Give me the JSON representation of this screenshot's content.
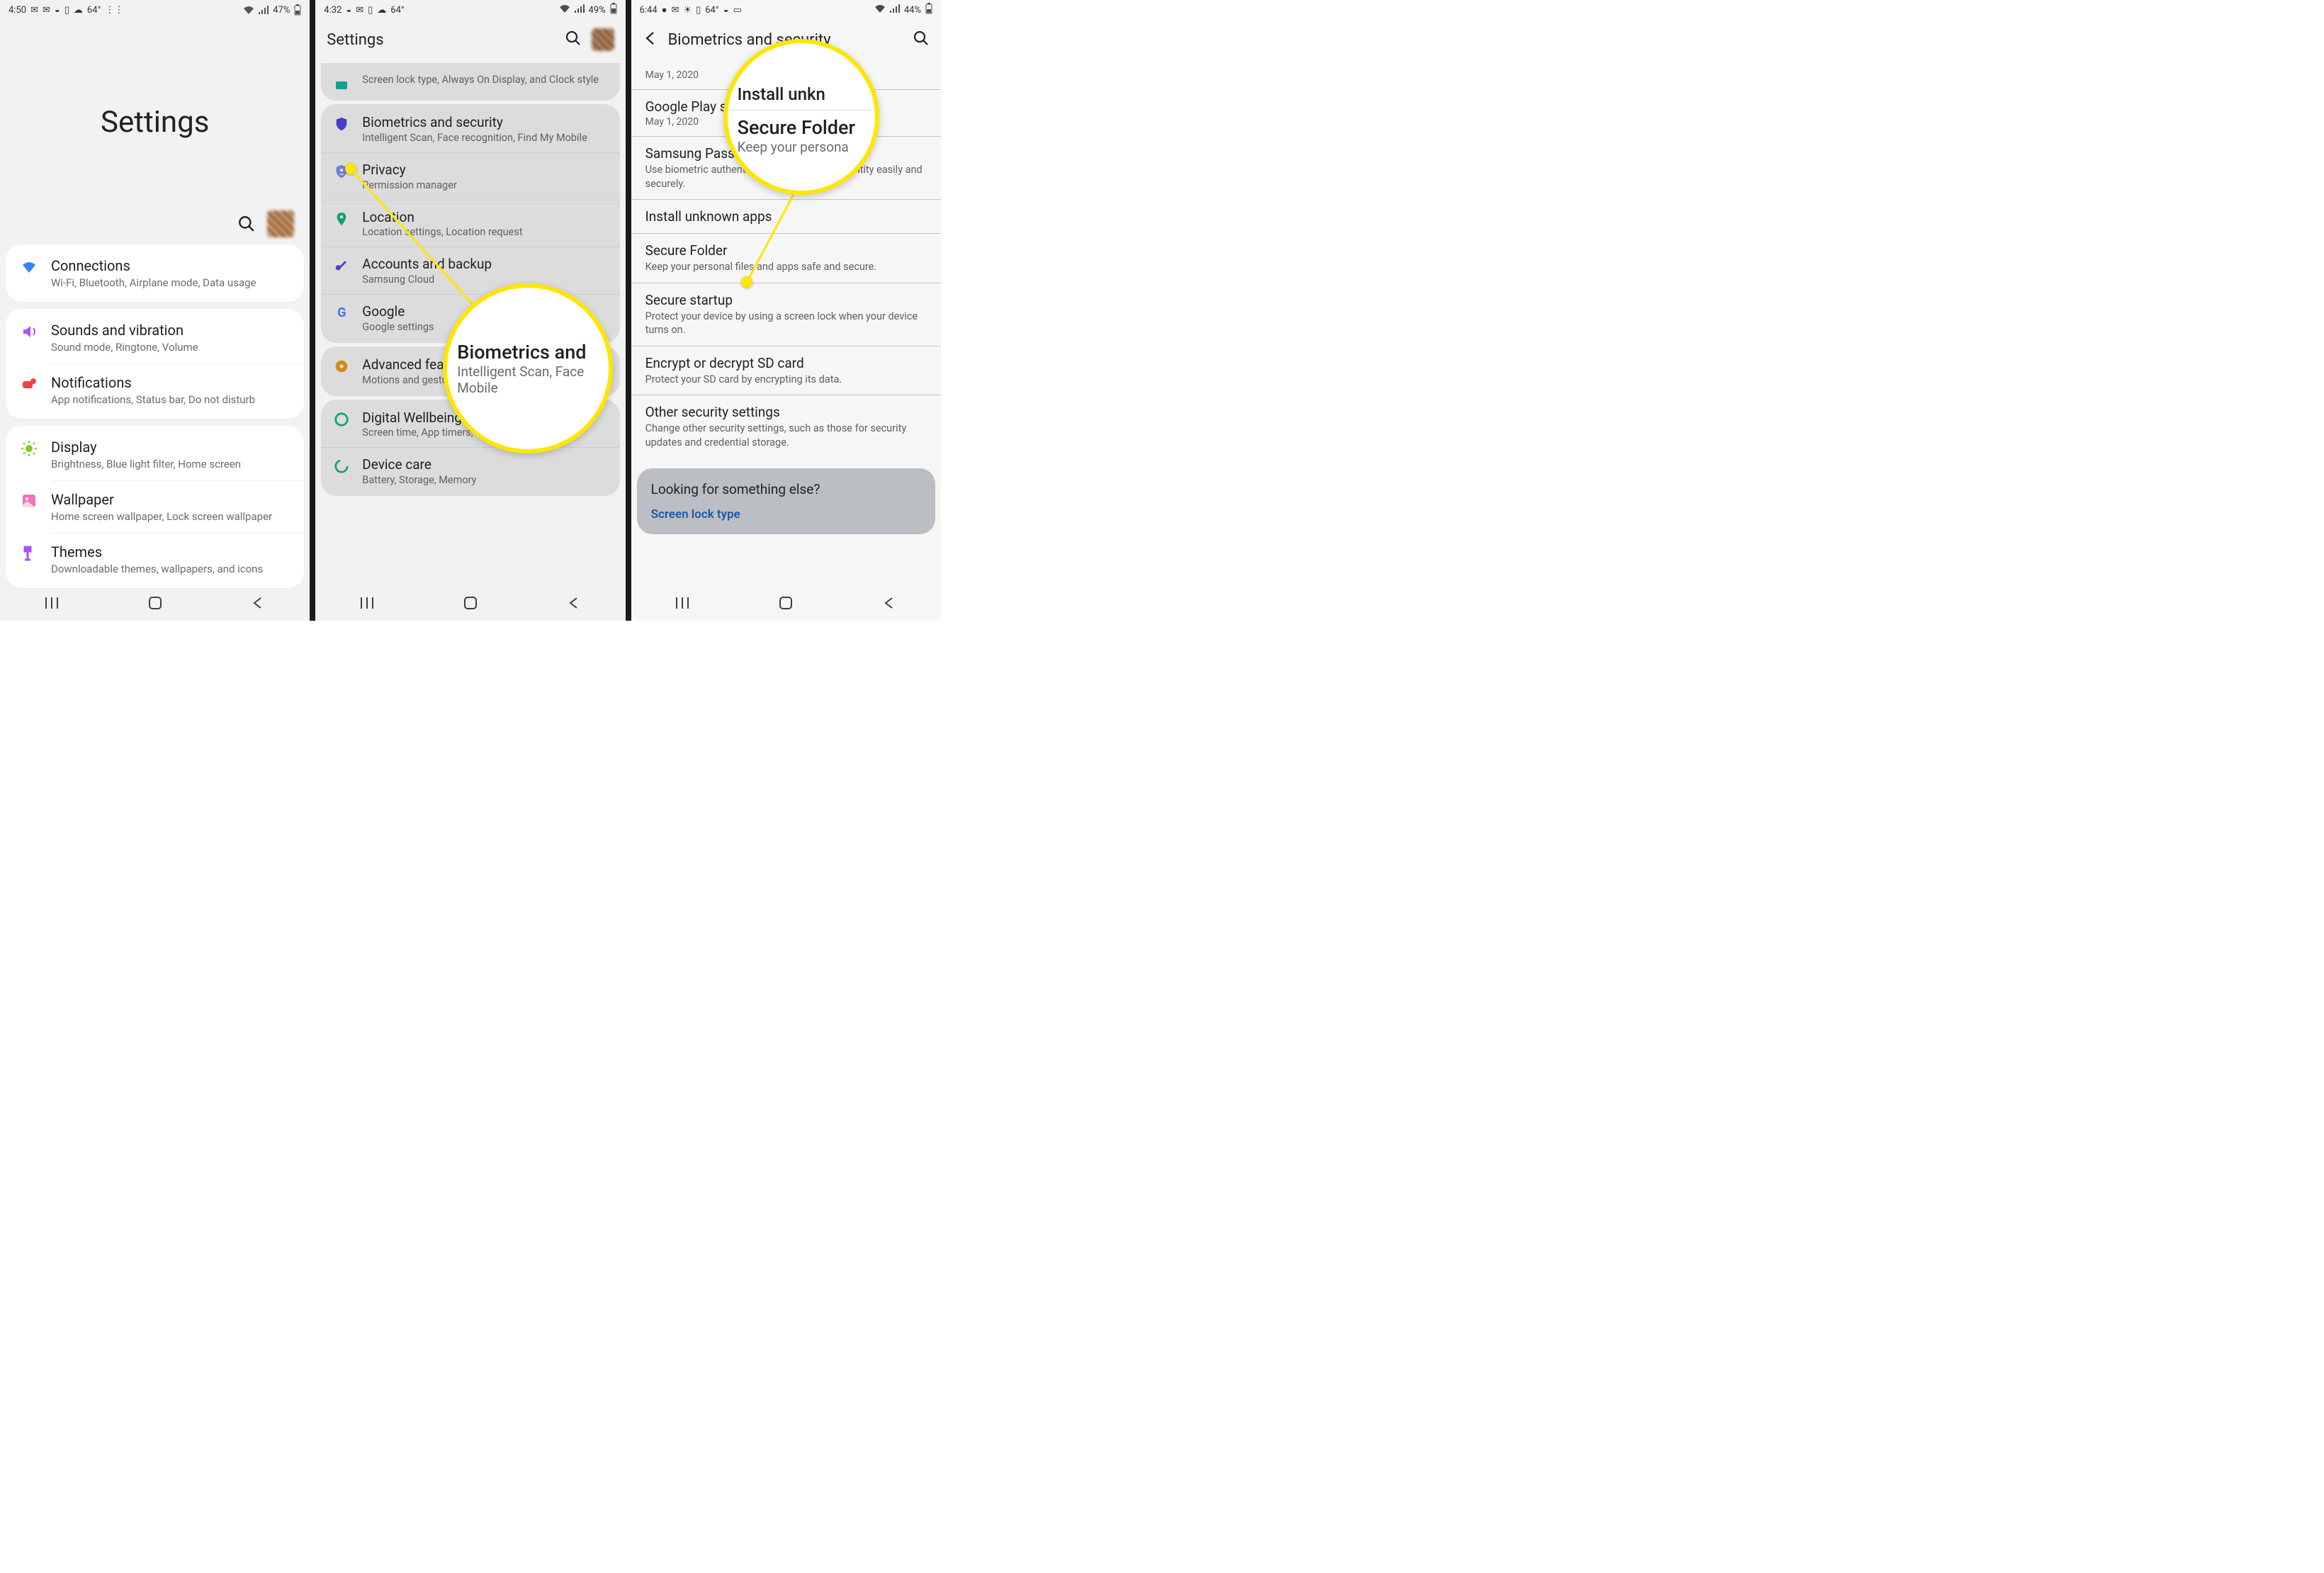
{
  "p1": {
    "status": {
      "time": "4:50",
      "temp": "64°",
      "battery": "47%"
    },
    "title": "Settings",
    "groups": [
      [
        {
          "icon": "wifi",
          "color": "#3b82f6",
          "title": "Connections",
          "sub": "Wi-Fi, Bluetooth, Airplane mode, Data usage"
        }
      ],
      [
        {
          "icon": "sound",
          "color": "#a855f7",
          "title": "Sounds and vibration",
          "sub": "Sound mode, Ringtone, Volume"
        },
        {
          "icon": "notif",
          "color": "#ef4444",
          "title": "Notifications",
          "sub": "App notifications, Status bar, Do not disturb"
        }
      ],
      [
        {
          "icon": "display",
          "color": "#84cc16",
          "title": "Display",
          "sub": "Brightness, Blue light filter, Home screen"
        },
        {
          "icon": "wallpaper",
          "color": "#f472b6",
          "title": "Wallpaper",
          "sub": "Home screen wallpaper, Lock screen wallpaper"
        },
        {
          "icon": "themes",
          "color": "#a855f7",
          "title": "Themes",
          "sub": "Downloadable themes, wallpapers, and icons"
        }
      ]
    ]
  },
  "p2": {
    "status": {
      "time": "4:32",
      "temp": "64°",
      "battery": "49%"
    },
    "header": "Settings",
    "top_partial": {
      "sub": "Screen lock type, Always On Display, and Clock style"
    },
    "groups": [
      [
        {
          "icon": "shield",
          "color": "#4f46e5",
          "title": "Biometrics and security",
          "sub": "Intelligent Scan, Face recognition, Find My Mobile"
        },
        {
          "icon": "privacy",
          "color": "#6366f1",
          "title": "Privacy",
          "sub": "Permission manager"
        },
        {
          "icon": "location",
          "color": "#10b981",
          "title": "Location",
          "sub": "Location settings, Location request"
        },
        {
          "icon": "key",
          "color": "#4f46e5",
          "title": "Accounts and backup",
          "sub": "Samsung Cloud"
        },
        {
          "icon": "google",
          "color": "#4285f4",
          "title": "Google",
          "sub": "Google settings"
        }
      ],
      [
        {
          "icon": "gear",
          "color": "#f59e0b",
          "title": "Advanced features",
          "sub": "Motions and gestures, One-handed mode"
        }
      ],
      [
        {
          "icon": "wellbeing",
          "color": "#10b981",
          "title": "Digital Wellbeing and parental controls",
          "sub": "Screen time, App timers, Wind Down"
        },
        {
          "icon": "care",
          "color": "#10b981",
          "title": "Device care",
          "sub": "Battery, Storage, Memory"
        }
      ]
    ],
    "mag": {
      "title": "Biometrics and",
      "sub1": "Intelligent Scan, Face",
      "sub2": "Mobile"
    }
  },
  "p3": {
    "status": {
      "time": "6:44",
      "temp": "64°",
      "battery": "44%"
    },
    "header": "Biometrics and security",
    "items": [
      {
        "title": "",
        "date": "May 1, 2020"
      },
      {
        "title": "Google Play system update",
        "date": "May 1, 2020"
      },
      {
        "title": "Samsung Pass",
        "sub": "Use biometric authentication to verify your identity easily and securely."
      },
      {
        "title": "Install unknown apps"
      },
      {
        "title": "Secure Folder",
        "sub": "Keep your personal files and apps safe and secure."
      },
      {
        "title": "Secure startup",
        "sub": "Protect your device by using a screen lock when your device turns on."
      },
      {
        "title": "Encrypt or decrypt SD card",
        "sub": "Protect your SD card by encrypting its data."
      },
      {
        "title": "Other security settings",
        "sub": "Change other security settings, such as those for security updates and credential storage."
      }
    ],
    "suggest": {
      "q": "Looking for something else?",
      "link": "Screen lock type"
    },
    "mag": {
      "top": "Install unkn",
      "title": "Secure Folder",
      "sub": "Keep your persona"
    }
  }
}
